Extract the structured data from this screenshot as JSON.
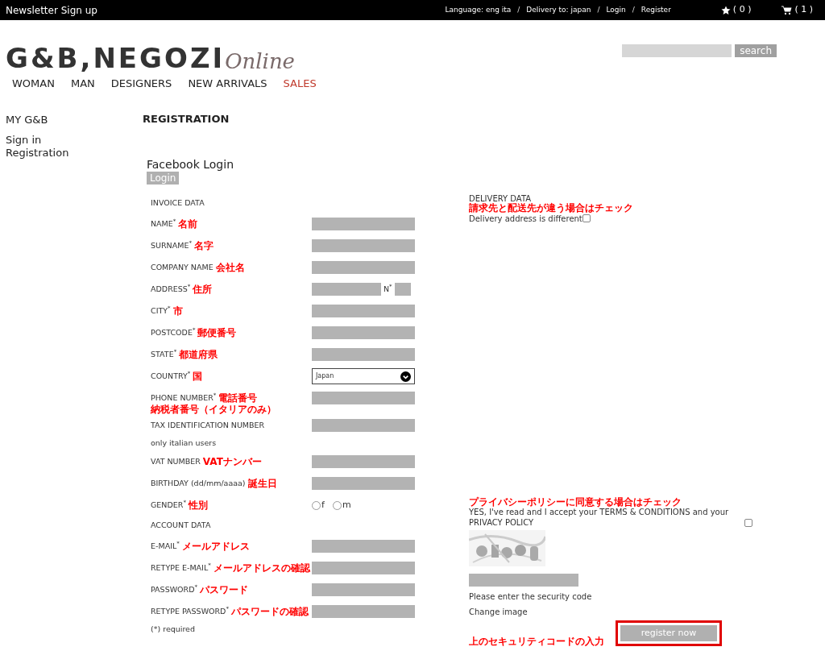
{
  "top_bar": {
    "newsletter": "Newsletter Sign up",
    "links": [
      {
        "kind": "link",
        "text": "Language: eng ita"
      },
      {
        "kind": "sep",
        "text": "/"
      },
      {
        "kind": "link",
        "text": "Delivery to: japan"
      },
      {
        "kind": "sep",
        "text": "/"
      },
      {
        "kind": "link",
        "text": "Login"
      },
      {
        "kind": "sep",
        "text": "/"
      },
      {
        "kind": "link",
        "text": "Register"
      }
    ],
    "wishlist_count": "( 0 )",
    "cart_count": "( 1 )"
  },
  "logo": {
    "main": "G&B,NEGOZI",
    "script": "Online"
  },
  "search": {
    "button": "search"
  },
  "nav": [
    {
      "label": "WOMAN",
      "highlight": false
    },
    {
      "label": "MAN",
      "highlight": false
    },
    {
      "label": "DESIGNERS",
      "highlight": false
    },
    {
      "label": "NEW ARRIVALS",
      "highlight": false
    },
    {
      "label": "SALES",
      "highlight": true
    }
  ],
  "sidebar": {
    "heading": "MY G&B",
    "links": [
      "Sign in",
      "Registration"
    ]
  },
  "page_title": "REGISTRATION",
  "facebook": {
    "title": "Facebook Login",
    "button": "Login"
  },
  "form": [
    {
      "kind": "section",
      "label": "INVOICE DATA"
    },
    {
      "kind": "text",
      "label": "NAME$^{*}$",
      "note": "名前"
    },
    {
      "kind": "text",
      "label": "SURNAME$^{*}$",
      "note": "名字"
    },
    {
      "kind": "text",
      "label": "COMPANY NAME",
      "note": "会社名"
    },
    {
      "kind": "address",
      "label": "ADDRESS$^{*}$",
      "note": "住所",
      "number_label": "N$^{*}$"
    },
    {
      "kind": "text",
      "label": "CITY$^{*}$",
      "note": "市"
    },
    {
      "kind": "text",
      "label": "POSTCODE$^{*}$",
      "note": "郵便番号"
    },
    {
      "kind": "text",
      "label": "STATE$^{*}$",
      "note": "都道府県"
    },
    {
      "kind": "select",
      "label": "COUNTRY$^{*}$",
      "note": "国",
      "value": "Japan"
    },
    {
      "kind": "text",
      "label": "PHONE NUMBER$^{*}$",
      "note": "電話番号"
    },
    {
      "kind": "note",
      "text": "納税者番号（イタリアのみ）"
    },
    {
      "kind": "text",
      "label": "TAX IDENTIFICATION NUMBER"
    },
    {
      "kind": "hint",
      "text": "only italian users"
    },
    {
      "kind": "text",
      "label": "VAT NUMBER",
      "note": "VATナンバー"
    },
    {
      "kind": "text",
      "label": "BIRTHDAY (dd/mm/aaaa)",
      "note": "誕生日"
    },
    {
      "kind": "radio",
      "label": "GENDER$^{*}$",
      "note": "性別",
      "options": [
        {
          "label": "f",
          "selected": false
        },
        {
          "label": "m",
          "selected": false
        }
      ]
    },
    {
      "kind": "section",
      "label": "ACCOUNT DATA"
    },
    {
      "kind": "text",
      "label": "E-MAIL$^{*}$",
      "note": "メールアドレス"
    },
    {
      "kind": "text",
      "label": "RETYPE E-MAIL$^{*}$",
      "note": "メールアドレスの確認"
    },
    {
      "kind": "text",
      "label": "PASSWORD$^{*}$",
      "note": "パスワード"
    },
    {
      "kind": "text",
      "label": "RETYPE PASSWORD$^{*}$",
      "note": "パスワードの確認"
    },
    {
      "kind": "hint",
      "text": "(*) required"
    }
  ],
  "delivery": {
    "title": "DELIVERY DATA",
    "note": "請求先と配送先が違う場合はチェック",
    "checkbox_label": "Delivery address is different",
    "checked": false
  },
  "privacy": {
    "note": "プライバシーポリシーに同意する場合はチェック",
    "text": "YES, I've read and I accept your TERMS & CONDITIONS and your PRIVACY POLICY",
    "checked": false
  },
  "captcha": {
    "kind": "picture",
    "hint": "Please enter the security code",
    "change": "Change image",
    "note": "上のセキュリティコードの入力"
  },
  "register": {
    "label": "register now",
    "highlighted": true
  }
}
